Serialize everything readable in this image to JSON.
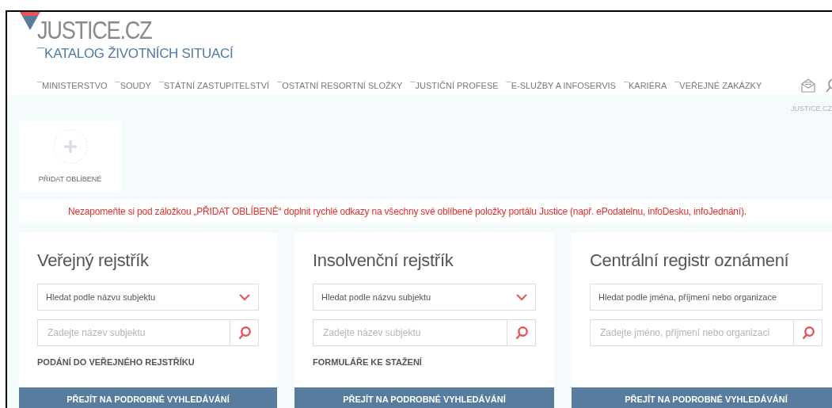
{
  "header": {
    "logo": "JUSTICE.CZ",
    "subtitle": "¯KATALOG ŽIVOTNÍCH SITUACÍ"
  },
  "nav": {
    "items": [
      "¯MINISTERSTVO",
      "¯SOUDY",
      "¯STÁTNÍ ZASTUPITELSTVÍ",
      "¯OSTATNÍ RESORTNÍ SLOŽKY",
      "¯JUSTIČNÍ PROFESE",
      "¯E-SLUŽBY A INFOSERVIS",
      "¯KARIÉRA",
      "¯VEŘEJNÉ ZAKÁZKY"
    ],
    "tool_label": "JUSTICE.CZ"
  },
  "favorites": {
    "label": "PŘIDAT OBLÍBENÉ"
  },
  "notice": "Nezapomeňte si pod záložkou „PŘIDAT OBLÍBENÉ“ doplnit rychlé odkazy na všechny své oblíbené položky portálu Justice (např. ePodatelnu, infoDesku, infoJednání).",
  "cards": [
    {
      "title": "Veřejný rejstřík",
      "selector": {
        "kind": "dropdown",
        "value": "Hledat podle názvu subjektu"
      },
      "search": {
        "placeholder": "Zadejte název subjektu"
      },
      "link": "PODÁNÍ DO VEŘEJNÉHO REJSTŘÍKU",
      "button": "PŘEJÍT NA PODROBNÉ VYHLEDÁVÁNÍ"
    },
    {
      "title": "Insolvenční rejstřík",
      "selector": {
        "kind": "dropdown",
        "value": "Hledat podle názvu subjektu"
      },
      "search": {
        "placeholder": "Zadejte název subjektu"
      },
      "link": "FORMULÁŘE KE STAŽENÍ",
      "button": "PŘEJÍT NA PODROBNÉ VYHLEDÁVÁNÍ"
    },
    {
      "title": "Centrální registr oznámení",
      "selector": {
        "kind": "field",
        "value": "Hledat podle jména, příjmení nebo organizace"
      },
      "search": {
        "placeholder": "Zadejte jméno, příjmení nebo organizaci"
      },
      "button": "PŘEJÍT NA PODROBNÉ VYHLEDÁVÁNÍ"
    }
  ]
}
